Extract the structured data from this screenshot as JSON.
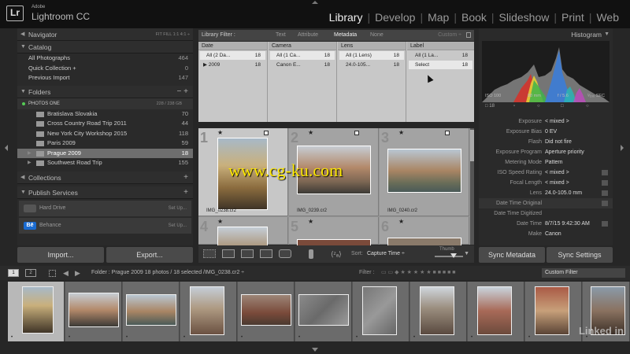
{
  "app": {
    "brand_small": "Adobe",
    "brand_name": "Lightroom CC",
    "logo": "Lr",
    "modules": [
      "Library",
      "Develop",
      "Map",
      "Book",
      "Slideshow",
      "Print",
      "Web"
    ],
    "active_module": "Library"
  },
  "left_panel": {
    "navigator": {
      "title": "Navigator",
      "options": "FIT   FILL   1:1   4:1 ÷"
    },
    "catalog": {
      "title": "Catalog",
      "items": [
        {
          "label": "All Photographs",
          "count": "464"
        },
        {
          "label": "Quick Collection +",
          "count": "0"
        },
        {
          "label": "Previous Import",
          "count": "147"
        }
      ]
    },
    "folders": {
      "title": "Folders",
      "volume": {
        "name": "PHOTOS ONE",
        "info": "228 / 238 GB"
      },
      "items": [
        {
          "label": "Bratislava Slovakia",
          "count": "70"
        },
        {
          "label": "Cross Country Road Trip 2011",
          "count": "44"
        },
        {
          "label": "New York City Workshop 2015",
          "count": "118"
        },
        {
          "label": "Paris 2009",
          "count": "59"
        },
        {
          "label": "Prague 2009",
          "count": "18"
        },
        {
          "label": "Southwest Road Trip",
          "count": "155"
        }
      ],
      "selected_index": 4
    },
    "collections": {
      "title": "Collections"
    },
    "publish_services": {
      "title": "Publish Services",
      "items": [
        {
          "label": "Hard Drive",
          "action": "Set Up..."
        },
        {
          "label": "Behance",
          "action": "Set Up...",
          "icon_text": "Bē"
        }
      ]
    },
    "import_label": "Import...",
    "export_label": "Export..."
  },
  "library_filter": {
    "label": "Library Filter :",
    "tabs": [
      "Text",
      "Attribute",
      "Metadata",
      "None"
    ],
    "active_tab": "Metadata",
    "preset": "Custom ÷",
    "columns": [
      {
        "header": "Date",
        "rows": [
          {
            "label": "All (2 Da...",
            "count": "18"
          },
          {
            "label": "▶ 2009",
            "count": "18"
          }
        ]
      },
      {
        "header": "Camera",
        "rows": [
          {
            "label": "All (1 Ca...",
            "count": "18"
          },
          {
            "label": "Canon E...",
            "count": "18"
          }
        ]
      },
      {
        "header": "Lens",
        "rows": [
          {
            "label": "All (1 Lens)",
            "count": "18"
          },
          {
            "label": "24.0-105...",
            "count": "18"
          }
        ]
      },
      {
        "header": "Label",
        "rows": [
          {
            "label": "All (1 La...",
            "count": "18"
          },
          {
            "label": "Select",
            "count": "18"
          }
        ]
      }
    ]
  },
  "grid": {
    "cells": [
      {
        "index": "1",
        "filename": "IMG_0238.cr2"
      },
      {
        "index": "2",
        "filename": "IMG_0239.cr2"
      },
      {
        "index": "3",
        "filename": "IMG_0240.cr2"
      },
      {
        "index": "4",
        "filename": ""
      },
      {
        "index": "5",
        "filename": ""
      },
      {
        "index": "6",
        "filename": ""
      }
    ],
    "star": "★"
  },
  "watermark": "www.cg-ku.com",
  "toolbar": {
    "sort_label": "Sort:",
    "sort_value": "Capture Time ÷",
    "thumb_label": "Thumb"
  },
  "right_panel": {
    "histogram_title": "Histogram",
    "hist_info": [
      "ISO 100",
      "88 mm",
      "f / 5.6",
      "¹⁄₁₀₀ SEC"
    ],
    "hist_icons": [
      "□ 18",
      "▫",
      "○",
      "□",
      "○"
    ],
    "metadata": [
      {
        "key": "Exposure",
        "value": "< mixed >"
      },
      {
        "key": "Exposure Bias",
        "value": "0 EV"
      },
      {
        "key": "Flash",
        "value": "Did not fire"
      },
      {
        "key": "Exposure Program",
        "value": "Aperture priority"
      },
      {
        "key": "Metering Mode",
        "value": "Pattern"
      },
      {
        "key": "ISO Speed Rating",
        "value": "< mixed >"
      },
      {
        "key": "Focal Length",
        "value": "< mixed >"
      },
      {
        "key": "Lens",
        "value": "24.0-105.0 mm"
      },
      {
        "key": "Date Time Original",
        "value": ""
      },
      {
        "key": "Date Time Digitized",
        "value": ""
      },
      {
        "key": "Date Time",
        "value": "8/7/15 9:42:30 AM"
      },
      {
        "key": "Make",
        "value": "Canon"
      }
    ],
    "sync_metadata": "Sync Metadata",
    "sync_settings": "Sync Settings"
  },
  "filmstrip_header": {
    "monitor1": "1",
    "monitor2": "2",
    "source": "Folder : Prague 2009     18 photos / 18 selected /IMG_0238.cr2 ÷",
    "filter_label": "Filter :",
    "filter_value": "Custom Filter"
  },
  "filmstrip": {
    "dots": "•"
  },
  "branding": "Linked in"
}
